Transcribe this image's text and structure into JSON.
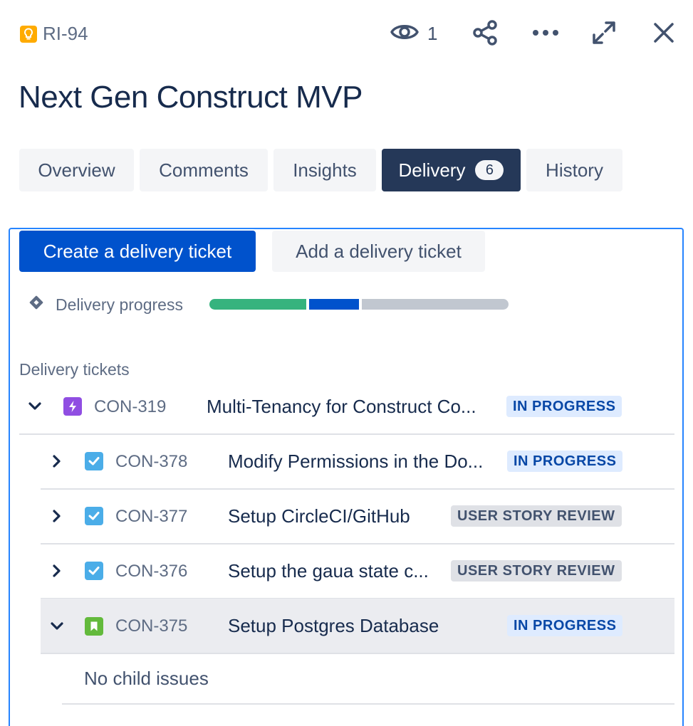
{
  "header": {
    "issue_key": "RI-94",
    "issue_type_icon": "lightbulb-icon",
    "watch_count": "1",
    "title": "Next Gen Construct MVP"
  },
  "tabs": [
    {
      "label": "Overview",
      "active": false
    },
    {
      "label": "Comments",
      "active": false
    },
    {
      "label": "Insights",
      "active": false
    },
    {
      "label": "Delivery",
      "active": true,
      "badge": "6"
    },
    {
      "label": "History",
      "active": false
    }
  ],
  "delivery": {
    "create_button": "Create a delivery ticket",
    "add_button": "Add a delivery ticket",
    "progress_label": "Delivery progress",
    "progress": {
      "done": 0.33,
      "in_progress": 0.17,
      "todo": 0.5
    },
    "section_heading": "Delivery tickets",
    "tickets": [
      {
        "key": "CON-319",
        "summary": "Multi-Tenancy for Construct Co...",
        "status": "IN PROGRESS",
        "type": "epic",
        "expanded": true,
        "level": 0
      },
      {
        "key": "CON-378",
        "summary": "Modify Permissions in the Do...",
        "status": "IN PROGRESS",
        "type": "task",
        "expanded": false,
        "level": 1
      },
      {
        "key": "CON-377",
        "summary": "Setup CircleCI/GitHub",
        "status": "USER STORY REVIEW",
        "type": "task",
        "expanded": false,
        "level": 1
      },
      {
        "key": "CON-376",
        "summary": "Setup the gaua state c...",
        "status": "USER STORY REVIEW",
        "type": "task",
        "expanded": false,
        "level": 1
      },
      {
        "key": "CON-375",
        "summary": "Setup Postgres Database",
        "status": "IN PROGRESS",
        "type": "story",
        "expanded": true,
        "level": 1
      }
    ],
    "empty_children": "No child issues"
  },
  "colors": {
    "brand_primary": "#0052CC",
    "tab_active": "#253858",
    "progress_done": "#36B37E",
    "progress_in_progress": "#0052CC",
    "progress_todo": "#C1C7D0",
    "lozenge_in_progress_bg": "#DEEBFF",
    "lozenge_in_progress_text": "#0747A6",
    "lozenge_review_bg": "#DFE1E6",
    "epic": "#904EE2",
    "task": "#4BADE8",
    "story": "#63BA3C",
    "idea": "#FFAB00"
  }
}
